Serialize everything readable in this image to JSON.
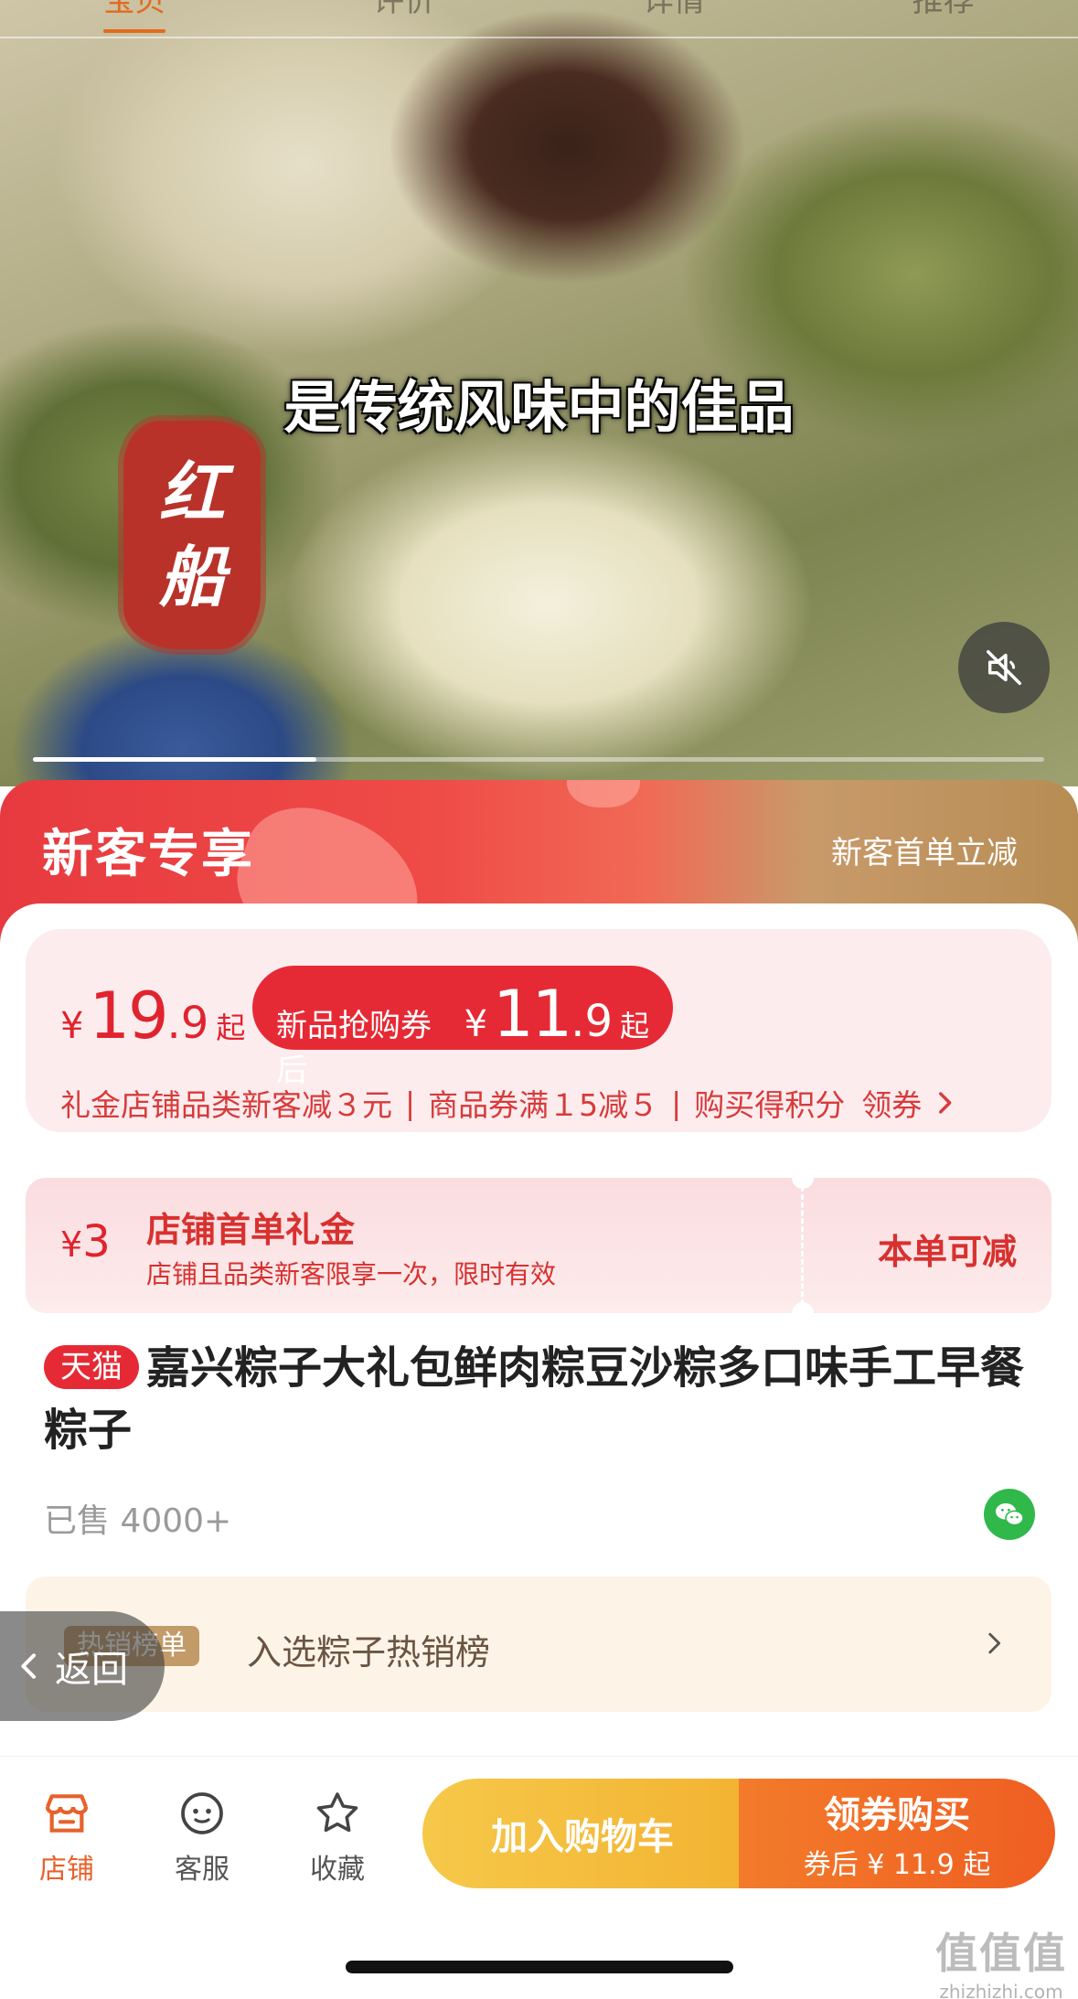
{
  "top_tabs": [
    "宝贝",
    "评价",
    "详情",
    "推荐"
  ],
  "media": {
    "caption": "是传统风味中的佳品",
    "seal_text": [
      "红",
      "船"
    ],
    "progress": 0.28,
    "mute_icon": "speaker-mute-icon"
  },
  "promo": {
    "title": "新客专享",
    "subtitle": "新客首单立减"
  },
  "price": {
    "currency": "¥",
    "int": "19",
    "dec": ".9",
    "suffix": "起",
    "coupon_label": "新品抢购券后",
    "coupon_int": "11",
    "coupon_dec": ".9",
    "coupon_suffix": "起",
    "line_items": [
      "礼金店铺品类新客减３元",
      "商品券满１5减５",
      "购买得积分"
    ],
    "separator": "|",
    "get_coupon": "领券"
  },
  "gift": {
    "currency": "¥",
    "amount": "3",
    "title": "店铺首单礼金",
    "desc": "店铺且品类新客限享一次，限时有效",
    "right": "本单可减"
  },
  "product": {
    "badge": "天猫",
    "title": "嘉兴粽子大礼包鲜肉粽豆沙粽多口味手工早餐粽子",
    "sold": "已售 4000+"
  },
  "rank": {
    "tag": "热销榜单",
    "text": "入选粽子热销榜"
  },
  "back": {
    "label": "返回"
  },
  "bottom": {
    "store": "店铺",
    "service": "客服",
    "favorite": "收藏",
    "cart": "加入购物车",
    "buy": "领券购买",
    "buy_sub": "券后 ¥ 11.9 起"
  },
  "watermark": {
    "main": "值值值",
    "sub": "zhizhizhi.com"
  },
  "colors": {
    "accent": "#e62a35",
    "orange": "#ef5e22",
    "yellow": "#f3b332"
  }
}
